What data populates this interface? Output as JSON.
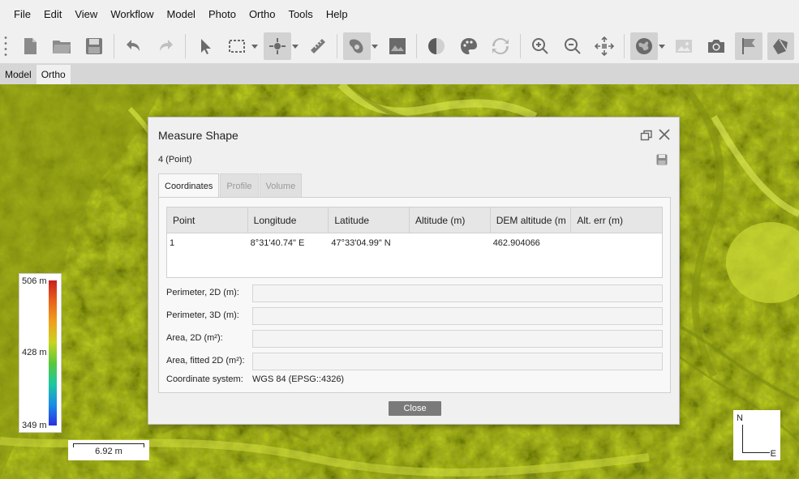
{
  "menu": [
    {
      "label": "File"
    },
    {
      "label": "Edit"
    },
    {
      "label": "View"
    },
    {
      "label": "Workflow"
    },
    {
      "label": "Model"
    },
    {
      "label": "Photo"
    },
    {
      "label": "Ortho"
    },
    {
      "label": "Tools"
    },
    {
      "label": "Help"
    }
  ],
  "toolbar": {
    "icons": [
      "new-document-icon",
      "open-folder-icon",
      "save-icon",
      "undo-icon",
      "redo-icon",
      "pointer-icon",
      "rectangle-select-icon",
      "point-marker-icon",
      "ruler-icon",
      "shape-tool-icon",
      "image-edit-icon",
      "contrast-icon",
      "palette-icon",
      "refresh-icon",
      "zoom-in-icon",
      "zoom-out-icon",
      "fit-view-icon",
      "globe-icon",
      "image-icon",
      "camera-icon",
      "flag-icon",
      "flag-shape-icon"
    ]
  },
  "view_tabs": [
    {
      "label": "Model",
      "active": false
    },
    {
      "label": "Ortho",
      "active": true
    }
  ],
  "legend": {
    "max": "506 m",
    "mid": "428 m",
    "min": "349 m"
  },
  "scale": {
    "label": "6.92 m"
  },
  "compass": {
    "north": "N",
    "east": "E"
  },
  "dialog": {
    "title": "Measure Shape",
    "subtitle": "4 (Point)",
    "tabs": [
      {
        "label": "Coordinates",
        "active": true
      },
      {
        "label": "Profile",
        "active": false
      },
      {
        "label": "Volume",
        "active": false
      }
    ],
    "table": {
      "headers": [
        "Point",
        "Longitude",
        "Latitude",
        "Altitude (m)",
        "DEM altitude (m",
        "Alt. err (m)"
      ],
      "rows": [
        [
          "1",
          "8°31'40.74\" E",
          "47°33'04.99\" N",
          "",
          "462.904066",
          ""
        ]
      ]
    },
    "fields": {
      "perimeter_2d": {
        "label": "Perimeter, 2D (m):",
        "value": ""
      },
      "perimeter_3d": {
        "label": "Perimeter, 3D (m):",
        "value": ""
      },
      "area_2d": {
        "label": "Area, 2D (m²):",
        "value": ""
      },
      "area_fitted": {
        "label": "Area, fitted 2D (m²):",
        "value": ""
      }
    },
    "crs": {
      "label": "Coordinate system:",
      "value": "WGS 84 (EPSG::4326)"
    },
    "close_label": "Close"
  },
  "colors": {
    "terrain_base": "#b8c81c",
    "terrain_shadow": "#6c7c10",
    "terrain_light": "#d8e43c"
  }
}
